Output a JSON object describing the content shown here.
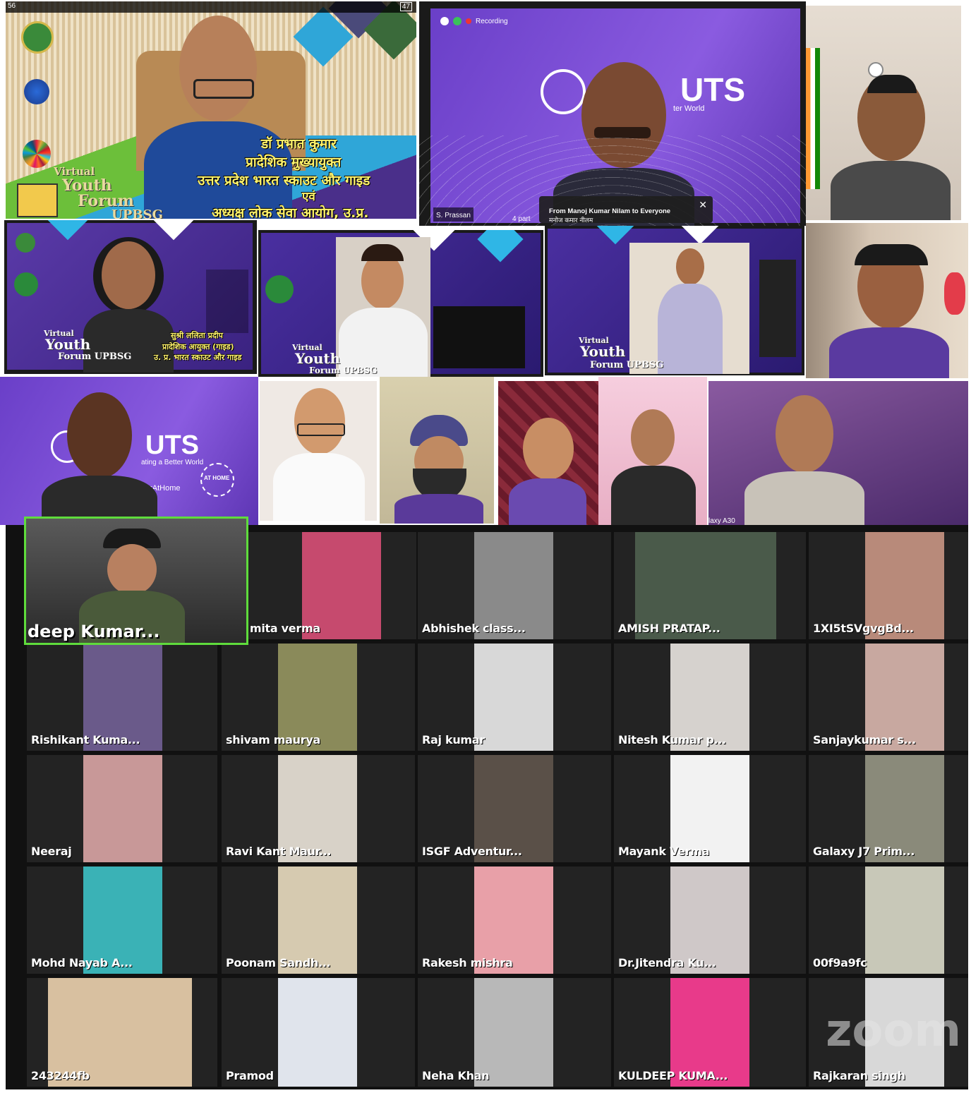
{
  "status_bar": {
    "signal": "56",
    "battery": "47"
  },
  "tiles": {
    "t1": {
      "line1": "डॉ प्रभात कुमार",
      "line2": "प्रादेशिक मुख्यायुक्त",
      "line3": "उत्तर प्रदेश भारत स्काउट और गाइड",
      "line4": "एवं",
      "line5": "अध्यक्ष लोक सेवा आयोग, उ.प्र.",
      "virtual": "Virtual",
      "youth": "Youth",
      "forum": "Forum",
      "upbsg": "UPBSG"
    },
    "t2": {
      "recording": "Recording",
      "logo_text": "UTS",
      "tagline": "ter World",
      "name_tag": "S. Prassan",
      "participants": "4 part",
      "chat_from": "From Manoj Kumar Nilam to Everyone",
      "chat_msg": "मनोज कमार नीलम"
    },
    "t4": {
      "caption1": "सुश्री ललिता प्रदीप",
      "caption2": "प्रादेशिक आयुक्त (गाइड)",
      "caption3": "उ. प्र. भारत स्काउट और गाइड",
      "youth": "Youth",
      "forum": "Forum UPBSG",
      "virtual": "Virtual"
    },
    "t5": {
      "virtual": "Virtual",
      "youth": "Youth",
      "forum": "Forum UPBSG"
    },
    "t6": {
      "virtual": "Virtual",
      "youth": "Youth",
      "forum": "Forum UPBSG"
    },
    "t8": {
      "logo_text": "UTS",
      "tagline": "ating a Better World",
      "badge": "AT HOME",
      "hashtag": "erAtHome"
    },
    "t13": {
      "device": "laxy A30"
    }
  },
  "big_speaker": {
    "name": "deep Kumar..."
  },
  "grid_names": [
    [
      "mita verma",
      "Abhishek class...",
      "AMISH PRATAP...",
      "1XI5tSVgvgBd..."
    ],
    [
      "Rishikant Kuma...",
      "shivam maurya",
      "Raj kumar",
      "Nitesh Kumar p...",
      "Sanjaykumar s..."
    ],
    [
      "Neeraj",
      "Ravi Kant Maur...",
      "ISGF Adventur...",
      "Mayank Verma",
      "Galaxy J7 Prim..."
    ],
    [
      "Mohd Nayab A...",
      "Poonam Sandh...",
      "Rakesh mishra",
      "Dr.Jitendra Ku...",
      "00f9a9fc"
    ],
    [
      "243244fb",
      "Pramod",
      "Neha Khan",
      "KULDEEP KUMA...",
      "Rajkaran singh"
    ]
  ],
  "watermark": "zoom"
}
